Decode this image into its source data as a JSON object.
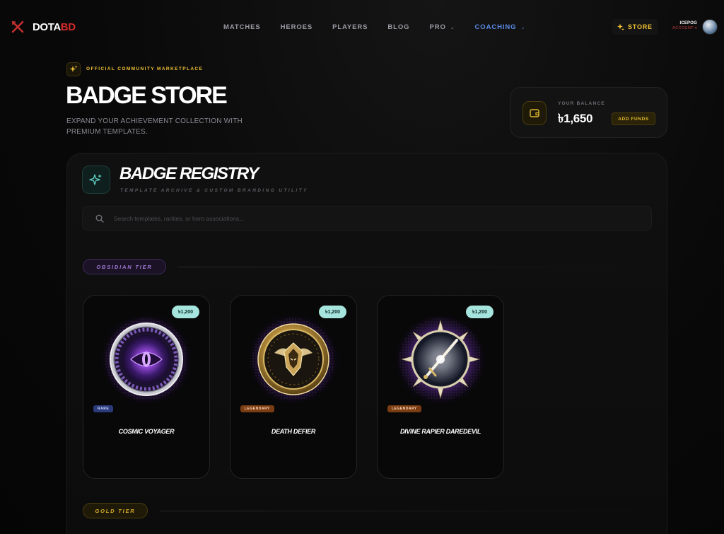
{
  "nav": {
    "brand": {
      "part1": "DOTA",
      "part2": "BD"
    },
    "links": [
      {
        "label": "MATCHES",
        "caret": false,
        "active": false
      },
      {
        "label": "HEROES",
        "caret": false,
        "active": false
      },
      {
        "label": "PLAYERS",
        "caret": false,
        "active": false
      },
      {
        "label": "BLOG",
        "caret": false,
        "active": false
      },
      {
        "label": "PRO",
        "caret": true,
        "active": false
      },
      {
        "label": "COACHING",
        "caret": true,
        "active": true
      }
    ],
    "store_label": "STORE",
    "account": {
      "name": "ICEPOG",
      "sub": "ACCOUNT ▾"
    }
  },
  "hero": {
    "eyebrow": "OFFICIAL COMMUNITY MARKETPLACE",
    "title": "BADGE STORE",
    "subtitle": "EXPAND YOUR ACHIEVEMENT COLLECTION WITH PREMIUM TEMPLATES."
  },
  "balance": {
    "label": "YOUR BALANCE",
    "value": "৳1,650",
    "add_funds_label": "ADD FUNDS"
  },
  "registry": {
    "title": "BADGE REGISTRY",
    "subtitle": "TEMPLATE ARCHIVE & CUSTOM BRANDING UTILITY",
    "search_placeholder": "Search templates, rarities, or hero associations..."
  },
  "tiers": [
    {
      "label": "OBSIDIAN TIER"
    },
    {
      "label": "GOLD TIER"
    }
  ],
  "cards": [
    {
      "name": "COSMIC VOYAGER",
      "price": "৳1,200",
      "rarity": "RARE",
      "art": "purple-eye-medallion"
    },
    {
      "name": "DEATH DEFIER",
      "price": "৳1,200",
      "rarity": "LEGENDARY",
      "art": "gold-winged-crest-medallion"
    },
    {
      "name": "DIVINE RAPIER DAREDEVIL",
      "price": "৳1,200",
      "rarity": "LEGENDARY",
      "art": "silver-sword-sunburst-medallion"
    }
  ],
  "colors": {
    "accent_gold": "#f1c232",
    "accent_blue": "#5b8be8",
    "brand_red": "#d22a2a",
    "price_pill": "#a6e4de",
    "obsidian_purple": "#a27ad8"
  }
}
